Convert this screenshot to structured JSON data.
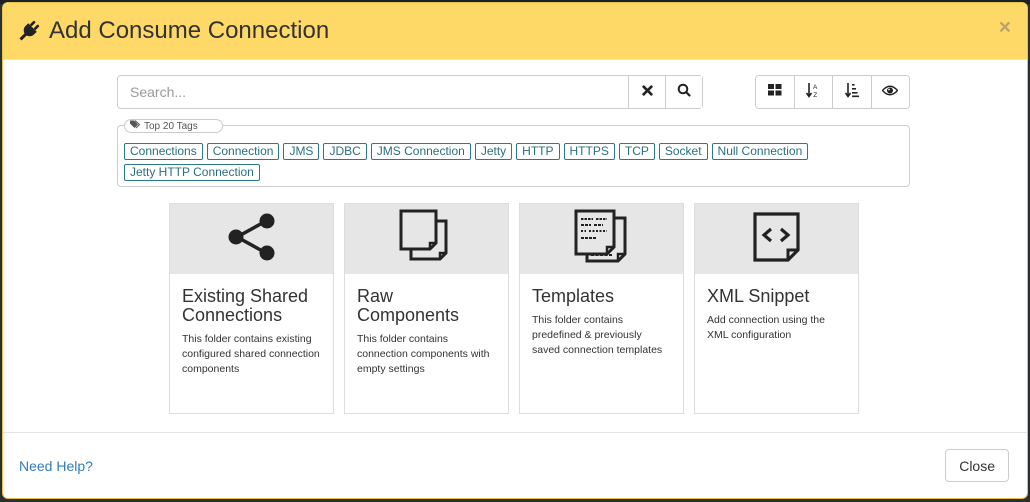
{
  "dialog": {
    "title": "Add Consume Connection",
    "title_icon": "plug-icon",
    "close_icon": "close-icon",
    "accent_color": "#fed967"
  },
  "search": {
    "placeholder": "Search...",
    "value": "",
    "clear_icon": "times-icon",
    "search_icon": "search-icon"
  },
  "view_toolbar": {
    "buttons": [
      {
        "name": "grid-view",
        "icon": "th-large-icon"
      },
      {
        "name": "sort-alpha",
        "icon": "sort-alpha-asc-icon"
      },
      {
        "name": "sort-amount",
        "icon": "sort-amount-asc-icon"
      },
      {
        "name": "preview",
        "icon": "eye-icon"
      }
    ]
  },
  "tags": {
    "legend": "Top 20 Tags",
    "legend_icon": "tags-icon",
    "items": [
      "Connections",
      "Connection",
      "JMS",
      "JDBC",
      "JMS Connection",
      "Jetty",
      "HTTP",
      "HTTPS",
      "TCP",
      "Socket",
      "Null Connection",
      "Jetty HTTP Connection"
    ]
  },
  "cards": [
    {
      "title": "Existing Shared Connections",
      "description": "This folder contains existing configured shared connection components",
      "icon": "share-icon"
    },
    {
      "title": "Raw Components",
      "description": "This folder contains connection components with empty settings",
      "icon": "copy-pages-icon"
    },
    {
      "title": "Templates",
      "description": "This folder contains predefined & previously saved connection templates",
      "icon": "template-pages-icon"
    },
    {
      "title": "XML Snippet",
      "description": "Add connection using the XML configuration",
      "icon": "xml-code-icon"
    }
  ],
  "footer": {
    "help_link": "Need Help?",
    "close_label": "Close"
  }
}
